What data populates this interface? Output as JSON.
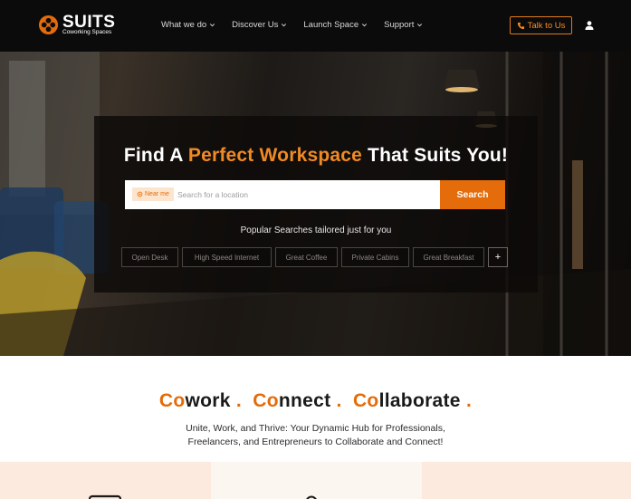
{
  "brand": {
    "name": "SUITS",
    "subtitle": "Coworking Spaces",
    "accent_color": "#e46c0a"
  },
  "nav": {
    "items": [
      {
        "label": "What we do",
        "icon": "chevron-down-icon"
      },
      {
        "label": "Discover Us",
        "icon": "chevron-down-icon"
      },
      {
        "label": "Launch Space",
        "icon": "chevron-down-icon"
      },
      {
        "label": "Support",
        "icon": "chevron-down-icon"
      }
    ],
    "cta_label": "Talk to Us",
    "cta_icon": "phone-icon",
    "user_icon": "user-icon"
  },
  "hero": {
    "headline_pre": "Find A",
    "headline_accent": "Perfect Workspace",
    "headline_post": "That Suits You!",
    "near_me_label": "Near me",
    "search_placeholder": "Search for a location",
    "search_button": "Search",
    "popular_title": "Popular Searches tailored just for you",
    "chips": [
      "Open Desk",
      "High Speed Internet",
      "Great Coffee",
      "Private Cabins",
      "Great Breakfast"
    ],
    "more_chip": "+"
  },
  "tagline": {
    "w1_accent": "Co",
    "w1_rest": "work",
    "w2_accent": "Co",
    "w2_rest": "nnect",
    "w3_accent": "Co",
    "w3_rest": "llaborate",
    "dot": ".",
    "line1": "Unite, Work, and Thrive: Your Dynamic Hub for Professionals,",
    "line2": "Freelancers, and Entrepreneurs to Collaborate and Connect!"
  },
  "cards": [
    {
      "icon": "laptop-icon"
    },
    {
      "icon": "location-pin-icon"
    },
    {
      "icon": ""
    }
  ]
}
